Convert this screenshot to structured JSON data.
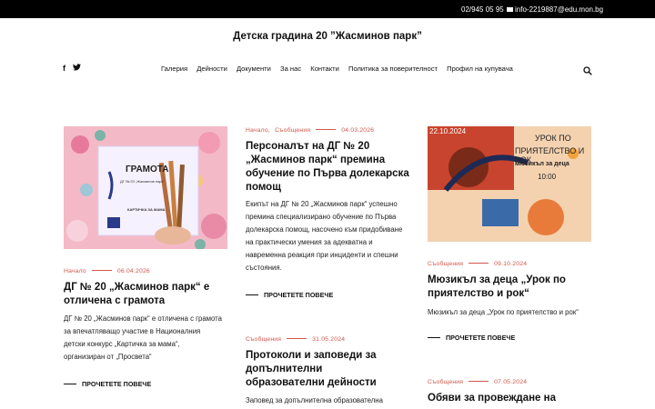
{
  "topbar": {
    "phone": "02/945 05 95",
    "email": "info-2219887@edu.mon.bg"
  },
  "site": {
    "title": "Детска градина 20 ”Жасминов парк”"
  },
  "nav": {
    "items": [
      "Галерия",
      "Дейности",
      "Документи",
      "За нас",
      "Контакти",
      "Политика за поверителност",
      "Профил на купувача"
    ]
  },
  "social": {
    "icons": [
      "facebook-icon",
      "twitter-icon"
    ]
  },
  "posts": {
    "p1": {
      "image_lines": [
        "ГРАМОТА",
        "ДГ № 20 „Жасминов парк“",
        "КАРТИЧКА ЗА МАМА"
      ],
      "cat": "Начало",
      "date": "06.04.2026",
      "title": "ДГ № 20 „Жасминов парк“ е отличена с грамота",
      "excerpt": " ДГ № 20 „Жасминов парк“ е отличена с грамота за впечатляващо участие в Националния детски конкурс „Картичка за мама“, организиран от  „Просвета“",
      "more": "ПРОЧЕТЕТЕ ПОВЕЧЕ"
    },
    "p2": {
      "cat1": "Начало",
      "cat2": "Съобщения",
      "date": "04.03.2026",
      "title": "Персоналът на ДГ № 20 „Жасминов парк“ премина обучение по Първа долекарска помощ",
      "excerpt": "Екипът на ДГ № 20 „Жасминов парк“ успешно премина специализирано обучение по  Първа долекарска помощ, насочено към придобиване на практически умения за адекватна  и навременна реакция при инциденти и спешни състояния.",
      "more": "ПРОЧЕТЕТЕ ПОВЕЧЕ"
    },
    "p3": {
      "image_lines": [
        "22.10.2024",
        "УРОК ПО",
        "ПРИЯТЕЛСТВО И РОК",
        "мюзикъл за деца",
        "10:00"
      ],
      "cat": "Съобщения",
      "date": "09.10.2024",
      "title": "Мюзикъл за деца „Урок по приятелство и рок“",
      "excerpt": "Мюзикъл за деца „Урок по приятелство и рок“",
      "more": "ПРОЧЕТЕТЕ ПОВЕЧЕ"
    },
    "p4": {
      "cat": "Съобщения",
      "date": "31.05.2024",
      "title": "Протоколи и заповеди за допълнителни образователни дейности",
      "excerpt": "Заповед за допълнителна образователна"
    },
    "p5": {
      "cat": "Съобщения",
      "date": "07.05.2024",
      "title": "Обяви за провеждане на"
    }
  },
  "colors": {
    "accent": "#d2574a",
    "topbar": "#000000"
  }
}
